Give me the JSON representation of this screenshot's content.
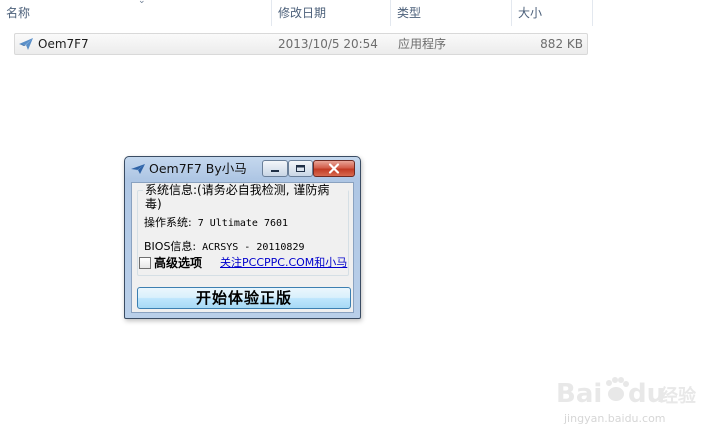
{
  "explorer": {
    "columns": [
      {
        "label": "名称"
      },
      {
        "label": "修改日期"
      },
      {
        "label": "类型"
      },
      {
        "label": "大小"
      }
    ],
    "files": [
      {
        "name": "Oem7F7",
        "modified": "2013/10/5 20:54",
        "type": "应用程序",
        "size": "882 KB",
        "icon": "app-plane-icon"
      }
    ]
  },
  "app_window": {
    "title": "Oem7F7 By小马",
    "title_icon": "plane-icon",
    "group_title": "系统信息:(请务必自我检测, 谨防病毒)",
    "os_label": "操作系统:",
    "os_value": "7 Ultimate 7601",
    "bios_label": "BIOS信息:",
    "bios_value": "ACRSYS - 20110829",
    "advanced_label": "高级选项",
    "advanced_checked": false,
    "link_text": "关注PCCPPC.COM和小马",
    "start_button": "开始体验正版"
  },
  "watermark": {
    "brand": "Bai",
    "brand2": "du",
    "brand_cn": "经验",
    "url": "jingyan.baidu.com"
  },
  "colors": {
    "title_gradient_top": "#c5d8ee",
    "close_button": "#c23b25",
    "link": "#0000cc",
    "header_text": "#4c607a"
  }
}
